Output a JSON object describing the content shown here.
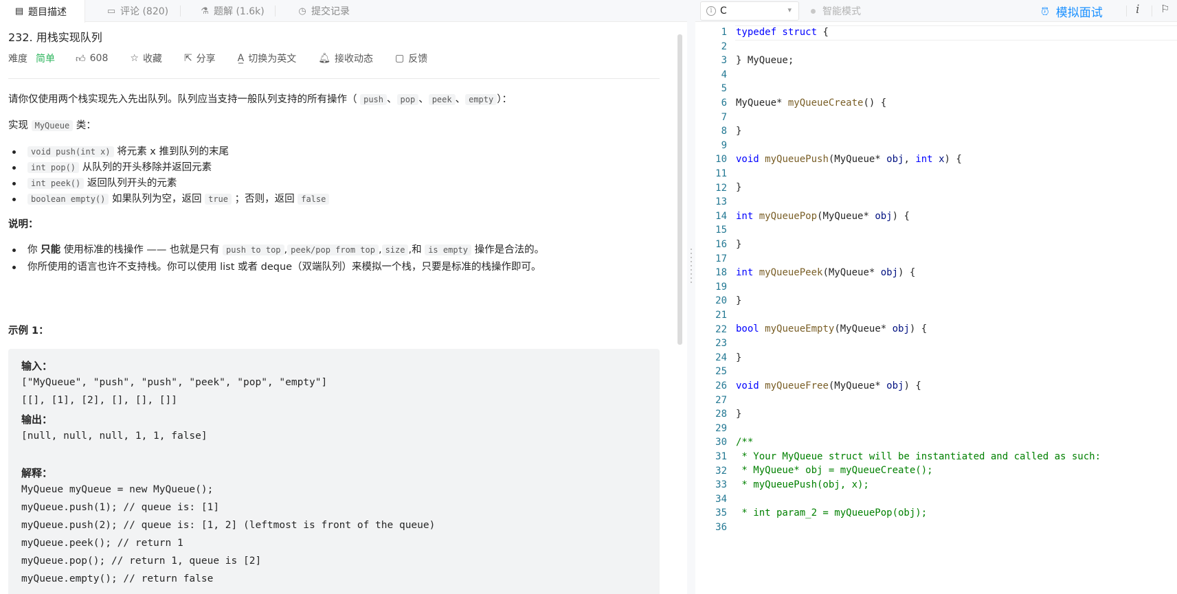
{
  "tabs": [
    {
      "label": "题目描述",
      "icon": "description-icon"
    },
    {
      "label": "评论 (820)",
      "icon": "comment-icon"
    },
    {
      "label": "题解 (1.6k)",
      "icon": "flask-icon"
    },
    {
      "label": "提交记录",
      "icon": "history-icon"
    }
  ],
  "question": {
    "title": "232. 用栈实现队列",
    "difficulty_label": "难度",
    "difficulty": "简单",
    "likes": "608",
    "actions": {
      "favorite": "收藏",
      "share": "分享",
      "switch_lang": "切换为英文",
      "subscribe": "接收动态",
      "feedback": "反馈"
    },
    "intro": {
      "text": "请你仅使用两个栈实现先入先出队列。队列应当支持一般队列支持的所有操作（",
      "ops": [
        "push",
        "pop",
        "peek",
        "empty"
      ],
      "sep": "、",
      "end": "）："
    },
    "impl": {
      "prefix": "实现",
      "cls": "MyQueue",
      "suffix": "类："
    },
    "methods": [
      {
        "code": "void push(int x)",
        "text": "将元素 x 推到队列的末尾"
      },
      {
        "code": "int pop()",
        "text": "从队列的开头移除并返回元素"
      },
      {
        "code": "int peek()",
        "text": "返回队列开头的元素"
      },
      {
        "code": "boolean empty()",
        "text": "如果队列为空，返回",
        "code2": "true",
        "mid": "；否则，返回",
        "code3": "false"
      }
    ],
    "notes_title": "说明：",
    "notes": {
      "n1_a": "你",
      "n1_b": "只能",
      "n1_c": "使用标准的栈操作 —— 也就是只有",
      "n1_ops": [
        "push to top",
        "peek/pop from top",
        "size"
      ],
      "n1_and": "和",
      "n1_last": "is empty",
      "n1_end": "操作是合法的。",
      "n2": "你所使用的语言也许不支持栈。你可以使用 list 或者 deque（双端队列）来模拟一个栈，只要是标准的栈操作即可。"
    },
    "example": {
      "title": "示例 1：",
      "input_label": "输入：",
      "input_1": "[\"MyQueue\", \"push\", \"push\", \"peek\", \"pop\", \"empty\"]",
      "input_2": "[[], [1], [2], [], [], []]",
      "output_label": "输出：",
      "output": "[null, null, null, 1, 1, false]",
      "explain_label": "解释：",
      "explain": [
        "MyQueue myQueue = new MyQueue();",
        "myQueue.push(1); // queue is: [1]",
        "myQueue.push(2); // queue is: [1, 2] (leftmost is front of the queue)",
        "myQueue.peek(); // return 1",
        "myQueue.pop(); // return 1, queue is [2]",
        "myQueue.empty(); // return false"
      ]
    }
  },
  "editor_toolbar": {
    "language": "C",
    "smart_mode": "智能模式",
    "mock_interview": "模拟面试"
  },
  "code": {
    "line_numbers": [
      "1",
      "2",
      "3",
      "4",
      "5",
      "6",
      "7",
      "8",
      "9",
      "10",
      "11",
      "12",
      "13",
      "14",
      "15",
      "16",
      "17",
      "18",
      "19",
      "20",
      "21",
      "22",
      "23",
      "24",
      "25",
      "26",
      "27",
      "28",
      "29",
      "30",
      "31",
      "32",
      "33",
      "34",
      "35",
      "36"
    ],
    "l1_kw": "typedef struct",
    "l1_b": " {",
    "l3": "} MyQueue;",
    "l6_t": "MyQueue*",
    "l6_f": "myQueueCreate",
    "l6_e": "() {",
    "close": "}",
    "l10": {
      "kw": "void",
      "fn": "myQueuePush",
      "a": "(MyQueue* ",
      "v1": "obj",
      "b": ", ",
      "kw2": "int",
      "v2": "x",
      "c": ") {"
    },
    "l14": {
      "kw": "int",
      "fn": "myQueuePop",
      "a": "(MyQueue* ",
      "v1": "obj",
      "c": ") {"
    },
    "l18": {
      "kw": "int",
      "fn": "myQueuePeek",
      "a": "(MyQueue* ",
      "v1": "obj",
      "c": ") {"
    },
    "l22": {
      "kw": "bool",
      "fn": "myQueueEmpty",
      "a": "(MyQueue* ",
      "v1": "obj",
      "c": ") {"
    },
    "l26": {
      "kw": "void",
      "fn": "myQueueFree",
      "a": "(MyQueue* ",
      "v1": "obj",
      "c": ") {"
    },
    "comment": [
      "/**",
      " * Your MyQueue struct will be instantiated and called as such:",
      " * MyQueue* obj = myQueueCreate();",
      " * myQueuePush(obj, x);",
      "",
      " * int param_2 = myQueuePop(obj);",
      ""
    ]
  },
  "colors": {
    "accent": "#1a90ff",
    "easy": "#2db55d",
    "keyword": "#0000ff",
    "function": "#795e26",
    "comment": "#008000",
    "line_number": "#237893"
  }
}
